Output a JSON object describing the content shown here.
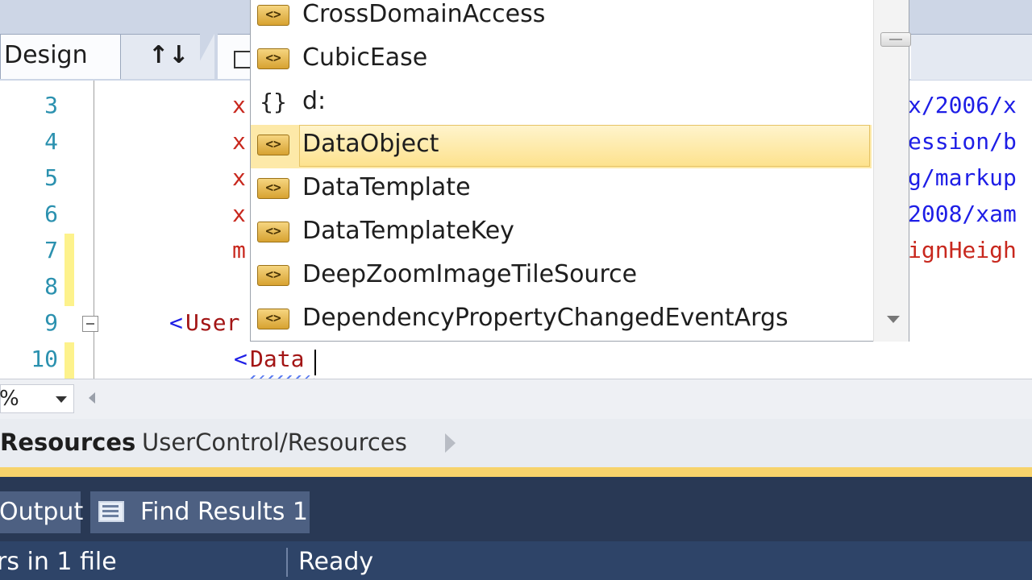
{
  "tabs": {
    "design_label": "Design",
    "swap_label": "↑↓"
  },
  "editor": {
    "line_numbers": [
      "3",
      "4",
      "5",
      "6",
      "7",
      "8",
      "9",
      "10"
    ],
    "lines": {
      "l3_left": "x",
      "l3_right": "x/2006/x",
      "l4_left": "x",
      "l4_right": "ession/b",
      "l5_left": "x",
      "l5_right": "g/markup",
      "l6_left": "x",
      "l6_right": "2008/xam",
      "l7_left": "m",
      "l7_right": "ignHeigh",
      "l9_bracket": "<",
      "l9_tag": "User",
      "l10_bracket": "<",
      "l10_typed": "Data"
    }
  },
  "intellisense": {
    "items": [
      {
        "icon": "<>",
        "label": "CrossDomainAccess",
        "selected": false
      },
      {
        "icon": "<>",
        "label": "CubicEase",
        "selected": false
      },
      {
        "icon": "{}",
        "label": "d:",
        "selected": false
      },
      {
        "icon": "<>",
        "label": "DataObject",
        "selected": true
      },
      {
        "icon": "<>",
        "label": "DataTemplate",
        "selected": false
      },
      {
        "icon": "<>",
        "label": "DataTemplateKey",
        "selected": false
      },
      {
        "icon": "<>",
        "label": "DeepZoomImageTileSource",
        "selected": false
      },
      {
        "icon": "<>",
        "label": "DependencyPropertyChangedEventArgs",
        "selected": false
      }
    ]
  },
  "zoom": {
    "value": "%"
  },
  "breadcrumb": {
    "first": "Resources",
    "second": "UserControl/Resources"
  },
  "tool_tabs": {
    "output": "Output",
    "find_results": "Find Results 1"
  },
  "status": {
    "left": "rs in 1 file",
    "right": "Ready"
  },
  "colors": {
    "selection": "#fde9a8",
    "tool_window": "#293955",
    "status_bar": "#2e4468",
    "accent_line": "#f7d36b"
  }
}
